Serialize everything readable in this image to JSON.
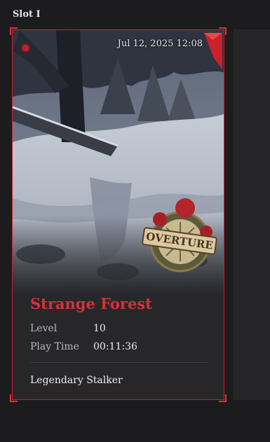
{
  "slot": {
    "label": "Slot I"
  },
  "card": {
    "timestamp": "Jul 12, 2025 12:08",
    "badge_text": "OVERTURE",
    "location": "Strange Forest",
    "stats": [
      {
        "label": "Level",
        "value": "10"
      },
      {
        "label": "Play Time",
        "value": "00:11:36"
      }
    ],
    "rank": "Legendary Stalker"
  },
  "colors": {
    "accent": "#d0343b",
    "border": "#c8222a",
    "background": "#1c1c1e"
  },
  "icons": [
    "red-gem-icon",
    "corner-flag-icon",
    "overture-badge-icon"
  ]
}
